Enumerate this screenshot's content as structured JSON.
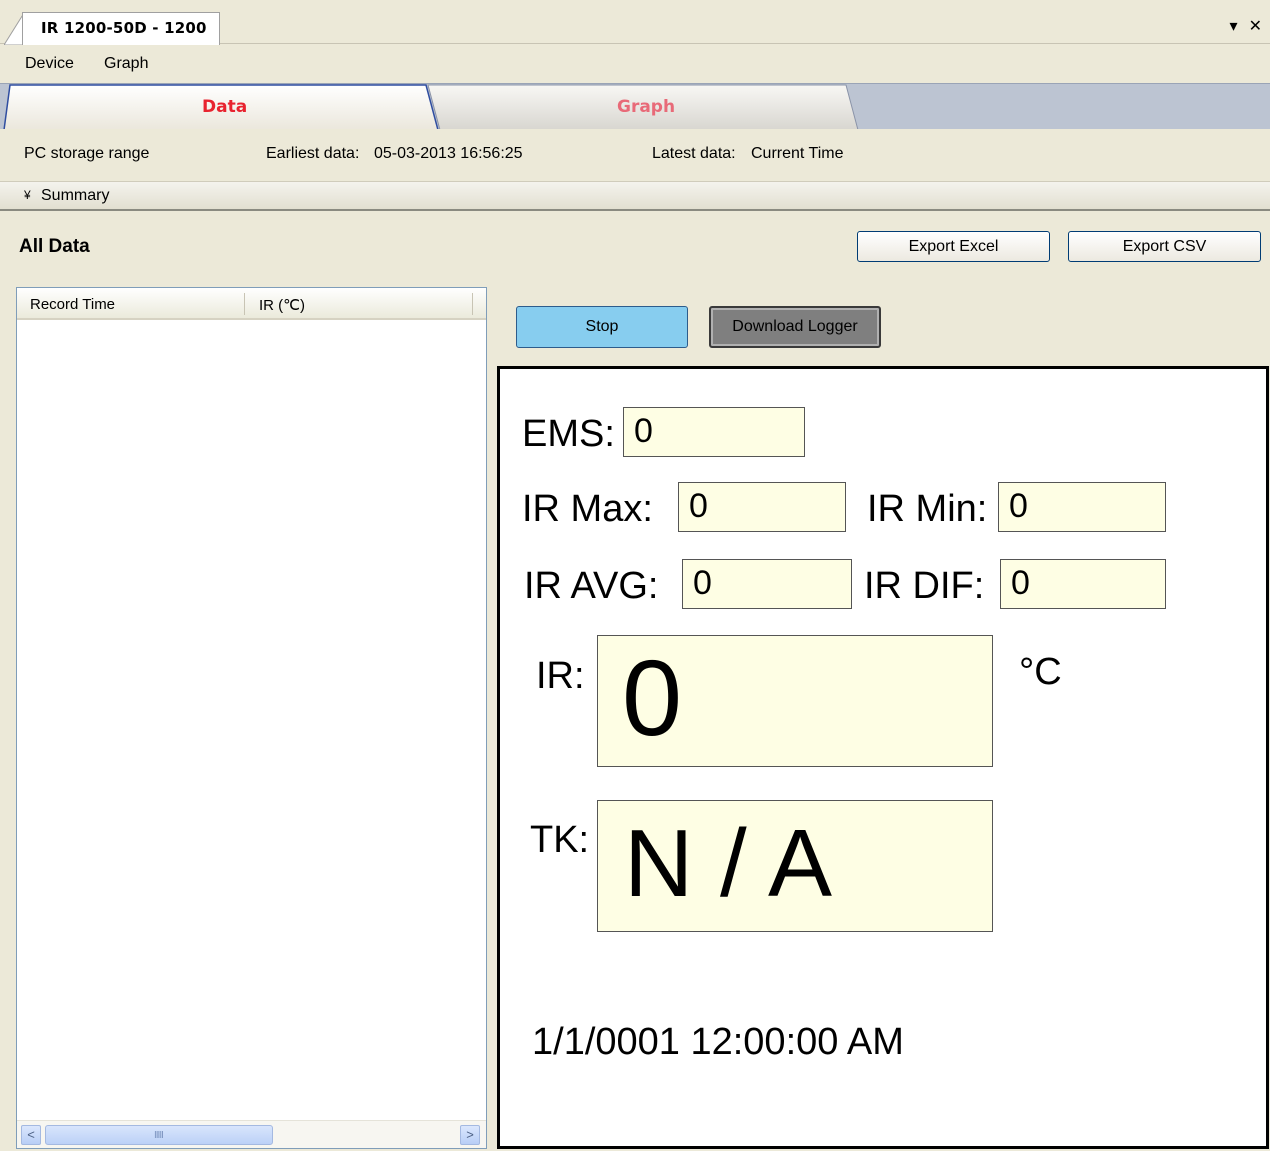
{
  "document_tab": {
    "title": "IR 1200-50D - 1200",
    "dropdown_icon": "▾",
    "close_icon": "✕"
  },
  "menu": {
    "items": [
      {
        "label": "Device"
      },
      {
        "label": "Graph"
      }
    ]
  },
  "view_tabs": {
    "items": [
      {
        "label": "Data",
        "active": true,
        "color": "#e8232f"
      },
      {
        "label": "Graph",
        "active": false,
        "color": "#e86a78"
      }
    ]
  },
  "storage_range": {
    "label": "PC storage range",
    "earliest_label": "Earliest data:",
    "earliest_value": "05-03-2013 16:56:25",
    "latest_label": "Latest data:",
    "latest_value": "Current Time"
  },
  "summary": {
    "icon": "chevron-double-down-icon",
    "glyph": "¥",
    "label": "Summary"
  },
  "all_data": {
    "title": "All Data",
    "export_excel_label": "Export Excel",
    "export_csv_label": "Export CSV"
  },
  "record_list": {
    "columns": [
      "Record Time",
      "IR (℃)"
    ],
    "rows": [],
    "scroll_left_glyph": "<",
    "scroll_right_glyph": ">",
    "scroll_grip_glyph": "IIIII"
  },
  "controls": {
    "stop_label": "Stop",
    "download_label": "Download Logger"
  },
  "readings": {
    "ems_label": "EMS:",
    "ems_value": "0",
    "ir_max_label": "IR Max:",
    "ir_max_value": "0",
    "ir_min_label": "IR Min:",
    "ir_min_value": "0",
    "ir_avg_label": "IR AVG:",
    "ir_avg_value": "0",
    "ir_dif_label": "IR DIF:",
    "ir_dif_value": "0",
    "ir_label": "IR:",
    "ir_value": "0",
    "ir_unit": "°C",
    "tk_label": "TK:",
    "tk_value": "N / A",
    "timestamp": "1/1/0001 12:00:00 AM"
  },
  "colors": {
    "window_bg": "#ece9d8",
    "stop_button": "#87cdef",
    "download_button": "#7f7f7f",
    "field_bg": "#fefee4"
  }
}
